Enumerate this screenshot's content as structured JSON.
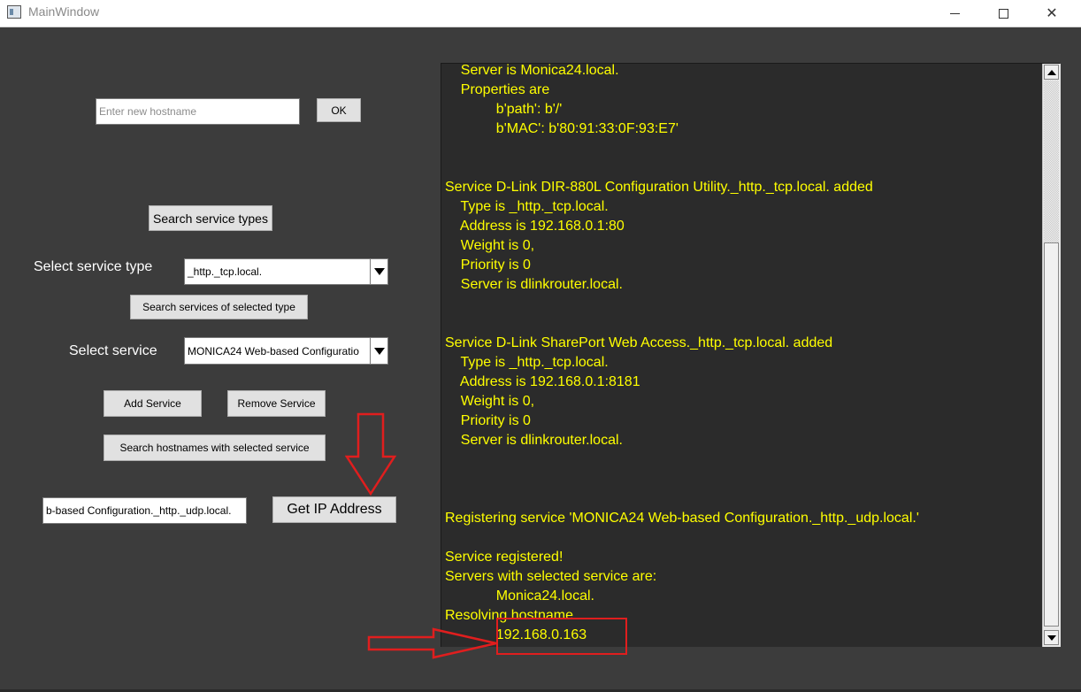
{
  "window": {
    "title": "MainWindow",
    "controls": [
      "minimize",
      "maximize",
      "close"
    ]
  },
  "hostname": {
    "placeholder": "Enter new hostname",
    "ok_label": "OK"
  },
  "search_types_label": "Search service types",
  "service_type": {
    "label": "Select service type",
    "value": "_http._tcp.local."
  },
  "search_services_label": "Search services of selected type",
  "service": {
    "label": "Select service",
    "value": "MONICA24 Web-based Configuratio"
  },
  "add_service_label": "Add Service",
  "remove_service_label": "Remove Service",
  "search_hostnames_label": "Search hostnames with selected service",
  "service_name_field": "b-based Configuration._http._udp.local.",
  "get_ip_label": "Get IP Address",
  "log": {
    "text_color": "#ffff00",
    "lines": [
      "    Server is Monica24.local.",
      "    Properties are",
      "             b'path': b'/'",
      "             b'MAC': b'80:91:33:0F:93:E7'",
      "",
      "",
      "Service D-Link DIR-880L Configuration Utility._http._tcp.local. added",
      "    Type is _http._tcp.local.",
      "    Address is 192.168.0.1:80",
      "    Weight is 0,",
      "    Priority is 0",
      "    Server is dlinkrouter.local.",
      "",
      "",
      "Service D-Link SharePort Web Access._http._tcp.local. added",
      "    Type is _http._tcp.local.",
      "    Address is 192.168.0.1:8181",
      "    Weight is 0,",
      "    Priority is 0",
      "    Server is dlinkrouter.local.",
      "",
      "",
      "",
      "Registering service 'MONICA24 Web-based Configuration._http._udp.local.'",
      "",
      "Service registered!",
      "Servers with selected service are:",
      "             Monica24.local.",
      "Resolving hostname...",
      "             192.168.0.163"
    ]
  },
  "annotations": {
    "color": "#e01e1e",
    "highlight_target": "resolved-ip-line"
  }
}
